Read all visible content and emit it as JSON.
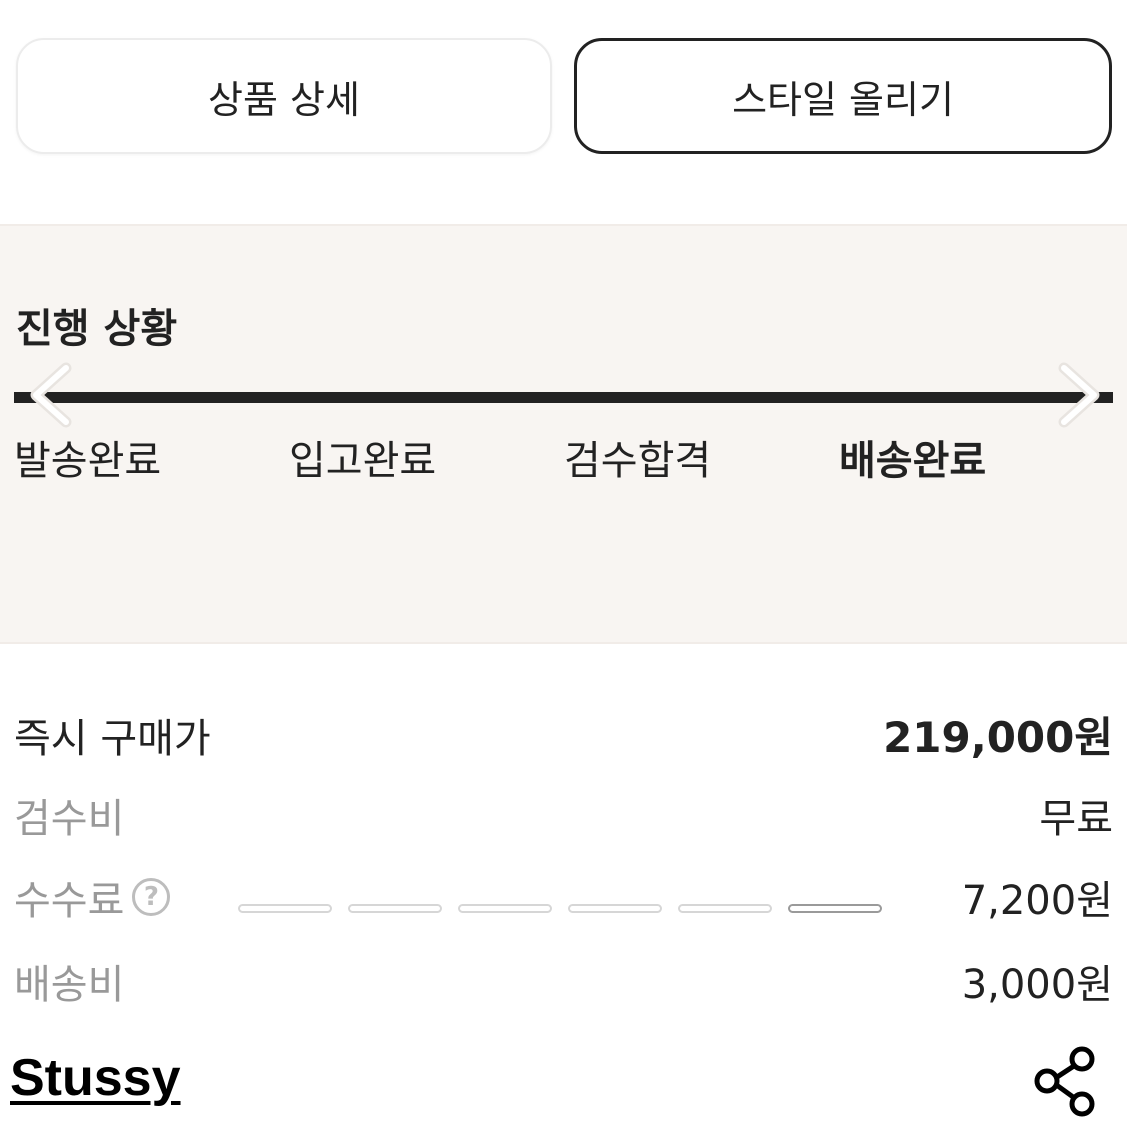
{
  "tabs": {
    "product_detail": "상품 상세",
    "upload_style": "스타일 올리기"
  },
  "progress": {
    "title": "진행 상황",
    "steps": [
      {
        "label": "발송완료",
        "active": false
      },
      {
        "label": "입고완료",
        "active": false
      },
      {
        "label": "검수합격",
        "active": false
      },
      {
        "label": "배송완료",
        "active": true
      }
    ]
  },
  "price": {
    "instant_buy": {
      "label": "즉시 구매가",
      "value": "219,000원"
    },
    "inspection_fee": {
      "label": "검수비",
      "value": "무료"
    },
    "commission": {
      "label": "수수료",
      "help": "?",
      "value": "7,200원"
    },
    "shipping_fee": {
      "label": "배송비",
      "value": "3,000원"
    }
  },
  "brand": {
    "name": "Stussy"
  },
  "icons": {
    "prev": "chevron-left-icon",
    "next": "chevron-right-icon",
    "share": "share-icon",
    "help": "question-circle-icon"
  },
  "colors": {
    "panel_bg": "#f8f5f2",
    "text_dark": "#222222",
    "text_muted": "#999999"
  }
}
